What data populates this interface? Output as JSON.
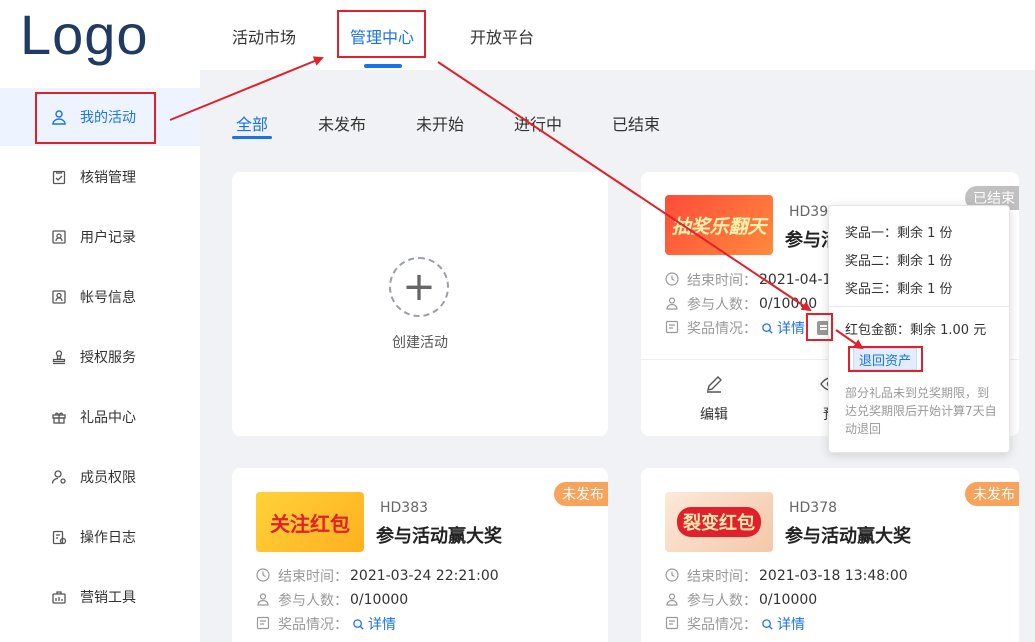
{
  "header": {
    "logo": "Logo",
    "nav": [
      "活动市场",
      "管理中心",
      "开放平台"
    ]
  },
  "sidebar": {
    "items": [
      {
        "label": "我的活动",
        "icon": "user-icon"
      },
      {
        "label": "核销管理",
        "icon": "clipboard-check-icon"
      },
      {
        "label": "用户记录",
        "icon": "id-card-icon"
      },
      {
        "label": "帐号信息",
        "icon": "id-badge-icon"
      },
      {
        "label": "授权服务",
        "icon": "stamp-icon"
      },
      {
        "label": "礼品中心",
        "icon": "gift-icon"
      },
      {
        "label": "成员权限",
        "icon": "user-settings-icon"
      },
      {
        "label": "操作日志",
        "icon": "log-icon"
      },
      {
        "label": "营销工具",
        "icon": "toolbox-icon"
      }
    ]
  },
  "tabs": [
    "全部",
    "未发布",
    "未开始",
    "进行中",
    "已结束"
  ],
  "create_card": {
    "label": "创建活动"
  },
  "cards": [
    {
      "code": "HD39",
      "title": "参与活",
      "status": "已结束",
      "thumb_text": "抽奖乐翻天",
      "end_label": "结束时间：",
      "end_value": "2021-04-1",
      "count_label": "参与人数：",
      "count_value": "0/10000",
      "prize_label": "奖品情况：",
      "detail": "详情",
      "actions": [
        "编辑",
        "预"
      ]
    },
    {
      "code": "HD383",
      "title": "参与活动赢大奖",
      "status": "未发布",
      "thumb_text": "关注红包",
      "end_label": "结束时间：",
      "end_value": "2021-03-24 22:21:00",
      "count_label": "参与人数：",
      "count_value": "0/10000",
      "prize_label": "奖品情况：",
      "detail": "详情"
    },
    {
      "code": "HD378",
      "title": "参与活动赢大奖",
      "status": "未发布",
      "thumb_text": "裂变红包",
      "end_label": "结束时间：",
      "end_value": "2021-03-18 13:48:00",
      "count_label": "参与人数：",
      "count_value": "0/10000",
      "prize_label": "奖品情况：",
      "detail": "详情"
    }
  ],
  "popover": {
    "prizes": [
      "奖品一：剩余 1 份",
      "奖品二：剩余 1 份",
      "奖品三：剩余 1 份"
    ],
    "red_packet": "红包金额：剩余 1.00 元",
    "return_button": "退回资产",
    "note": "部分礼品未到兑奖期限，到达兑奖期限后开始计算7天自动退回"
  },
  "colors": {
    "accent": "#1a73e8",
    "annotation": "#e0202b",
    "tag_orange": "#f7a35c",
    "tag_gray": "#c0c0c0"
  }
}
